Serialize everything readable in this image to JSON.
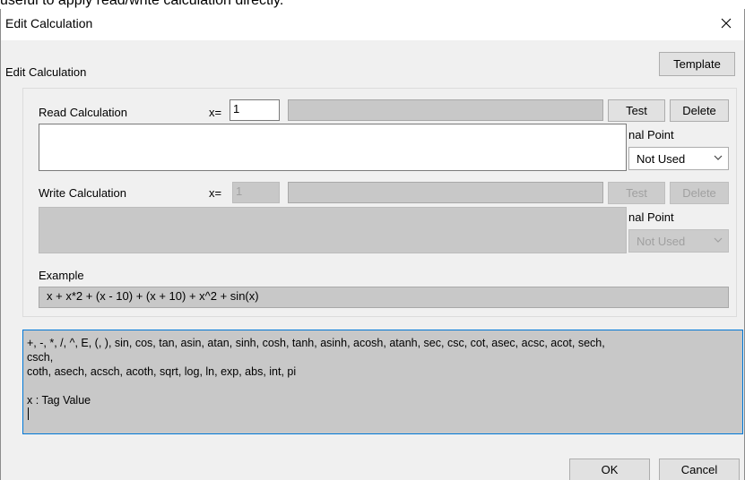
{
  "top_text": "useful to apply read/write calculation directly.",
  "window": {
    "title": "Edit Calculation",
    "close_glyph": "✕"
  },
  "section_label": "Edit Calculation",
  "template_button": "Template",
  "read": {
    "label": "Read Calculation",
    "x_label": "x=",
    "x_value": "1",
    "result_value": "",
    "test_button": "Test",
    "delete_button": "Delete",
    "decimal_label": "nal Point",
    "decimal_value": "Not Used",
    "expression": ""
  },
  "write": {
    "label": "Write Calculation",
    "x_label": "x=",
    "x_value": "1",
    "result_value": "",
    "test_button": "Test",
    "delete_button": "Delete",
    "decimal_label": "nal Point",
    "decimal_value": "Not Used",
    "expression": ""
  },
  "example": {
    "label": "Example",
    "value": "x + x*2 + (x - 10) + (x + 10) + x^2 + sin(x)"
  },
  "help": {
    "line1": "+, -, *, /, ^, E, (, ), sin, cos, tan, asin, atan, sinh, cosh, tanh, asinh, acosh, atanh, sec, csc, cot, asec, acsc, acot, sech,",
    "line2": "csch,",
    "line3": "coth, asech, acsch, acoth, sqrt, log, ln, exp, abs, int, pi",
    "line4": "x : Tag Value"
  },
  "ok_button": "OK",
  "cancel_button": "Cancel"
}
